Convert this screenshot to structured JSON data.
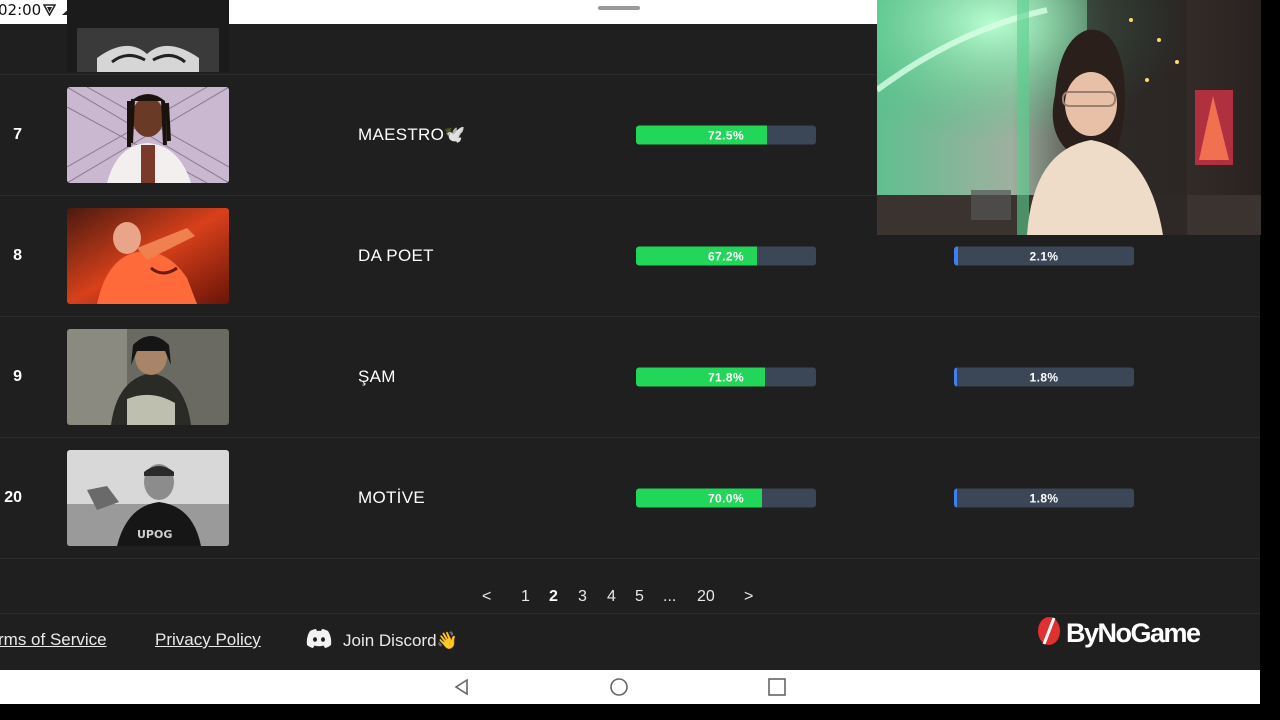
{
  "status": {
    "time": "02:00",
    "icons": [
      "vpn-icon",
      "network-icon",
      "accessibility-icon",
      "app-icon"
    ]
  },
  "rows": [
    {
      "rank": "",
      "name": "",
      "thumb": "artist-photo-partial"
    },
    {
      "rank": "7",
      "name": "MAESTRO🕊️",
      "primary": "72.5%",
      "primary_value": 72.5,
      "secondary": null
    },
    {
      "rank": "8",
      "name": "DA POET",
      "primary": "67.2%",
      "primary_value": 67.2,
      "secondary": "2.1%",
      "secondary_value": 2.1
    },
    {
      "rank": "9",
      "name": "ŞAM",
      "primary": "71.8%",
      "primary_value": 71.8,
      "secondary": "1.8%",
      "secondary_value": 1.8
    },
    {
      "rank": "20",
      "name": "MOTİVE",
      "primary": "70.0%",
      "primary_value": 70.0,
      "secondary": "1.8%",
      "secondary_value": 1.8
    }
  ],
  "pagination": {
    "prev": "<",
    "pages": [
      "1",
      "2",
      "3",
      "4",
      "5",
      "...",
      "20"
    ],
    "current": "2",
    "next": ">"
  },
  "footer": {
    "terms": "rms of Service",
    "privacy": "Privacy Policy",
    "discord": "Join Discord👋",
    "brand": "ByNoGame"
  },
  "colors": {
    "background": "#1f1f1f",
    "win_bar": "#22d65a",
    "pick_bar": "#3f7ff0",
    "bar_track": "#3b4656"
  }
}
